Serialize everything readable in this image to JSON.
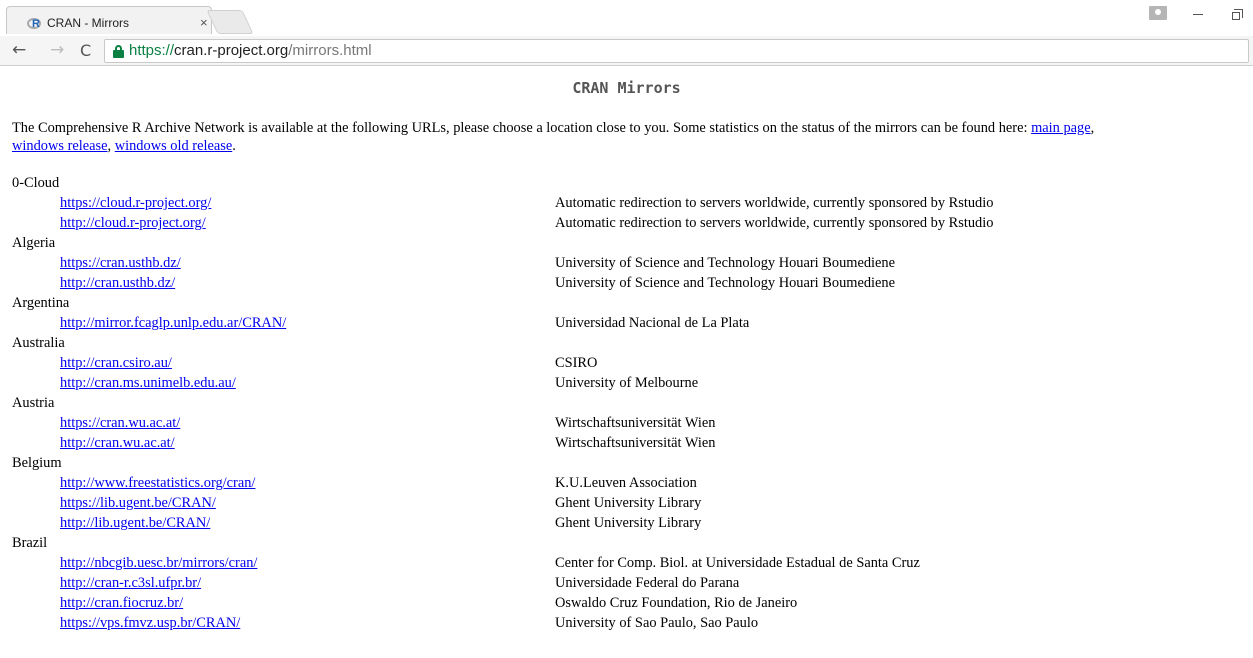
{
  "browser": {
    "tab_title": "CRAN - Mirrors",
    "tab_close": "×",
    "favicon_letter": "R",
    "url_scheme": "https://",
    "url_host": "cran.r-project.org",
    "url_path": "/mirrors.html",
    "back_glyph": "←",
    "forward_glyph": "→",
    "reload_glyph": "C"
  },
  "page": {
    "title": "CRAN Mirrors",
    "intro_text": "The Comprehensive R Archive Network is available at the following URLs, please choose a location close to you. Some statistics on the status of the mirrors can be found here: ",
    "links": {
      "main_page": "main page",
      "windows_release": "windows release",
      "windows_old_release": "windows old release"
    },
    "sep_1": ",",
    "sep_2": ", ",
    "end": "."
  },
  "countries": [
    {
      "name": "0-Cloud",
      "mirrors": [
        {
          "url": "https://cloud.r-project.org/",
          "desc": "Automatic redirection to servers worldwide, currently sponsored by Rstudio"
        },
        {
          "url": "http://cloud.r-project.org/",
          "desc": "Automatic redirection to servers worldwide, currently sponsored by Rstudio"
        }
      ]
    },
    {
      "name": "Algeria",
      "mirrors": [
        {
          "url": "https://cran.usthb.dz/",
          "desc": "University of Science and Technology Houari Boumediene"
        },
        {
          "url": "http://cran.usthb.dz/",
          "desc": "University of Science and Technology Houari Boumediene"
        }
      ]
    },
    {
      "name": "Argentina",
      "mirrors": [
        {
          "url": "http://mirror.fcaglp.unlp.edu.ar/CRAN/",
          "desc": "Universidad Nacional de La Plata"
        }
      ]
    },
    {
      "name": "Australia",
      "mirrors": [
        {
          "url": "http://cran.csiro.au/",
          "desc": "CSIRO"
        },
        {
          "url": "http://cran.ms.unimelb.edu.au/",
          "desc": "University of Melbourne"
        }
      ]
    },
    {
      "name": "Austria",
      "mirrors": [
        {
          "url": "https://cran.wu.ac.at/",
          "desc": "Wirtschaftsuniversität Wien"
        },
        {
          "url": "http://cran.wu.ac.at/",
          "desc": "Wirtschaftsuniversität Wien"
        }
      ]
    },
    {
      "name": "Belgium",
      "mirrors": [
        {
          "url": "http://www.freestatistics.org/cran/",
          "desc": "K.U.Leuven Association"
        },
        {
          "url": "https://lib.ugent.be/CRAN/",
          "desc": "Ghent University Library"
        },
        {
          "url": "http://lib.ugent.be/CRAN/",
          "desc": "Ghent University Library"
        }
      ]
    },
    {
      "name": "Brazil",
      "mirrors": [
        {
          "url": "http://nbcgib.uesc.br/mirrors/cran/",
          "desc": "Center for Comp. Biol. at Universidade Estadual de Santa Cruz"
        },
        {
          "url": "http://cran-r.c3sl.ufpr.br/",
          "desc": "Universidade Federal do Parana"
        },
        {
          "url": "http://cran.fiocruz.br/",
          "desc": "Oswaldo Cruz Foundation, Rio de Janeiro"
        },
        {
          "url": "https://vps.fmvz.usp.br/CRAN/",
          "desc": "University of Sao Paulo, Sao Paulo"
        }
      ]
    }
  ]
}
